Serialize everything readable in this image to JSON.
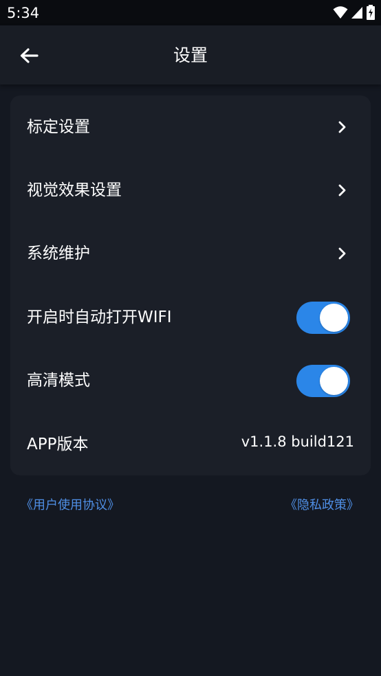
{
  "status_bar": {
    "time": "5:34",
    "icons": [
      "wifi-icon",
      "cellular-signal-icon",
      "battery-charging-icon"
    ]
  },
  "header": {
    "title": "设置",
    "back_icon": "arrow-left-icon"
  },
  "settings": {
    "calibration": {
      "label": "标定设置"
    },
    "visual_effects": {
      "label": "视觉效果设置"
    },
    "system_maintenance": {
      "label": "系统维护"
    },
    "auto_wifi": {
      "label": "开启时自动打开WIFI",
      "enabled": true
    },
    "hd_mode": {
      "label": "高清模式",
      "enabled": true
    },
    "app_version": {
      "label": "APP版本",
      "value": "v1.1.8 build121"
    }
  },
  "links": {
    "user_agreement": "《用户使用协议》",
    "privacy_policy": "《隐私政策》"
  },
  "colors": {
    "background": "#141821",
    "card": "#1b1f28",
    "toggle_on": "#2b86e8",
    "link": "#4f8fe6"
  }
}
